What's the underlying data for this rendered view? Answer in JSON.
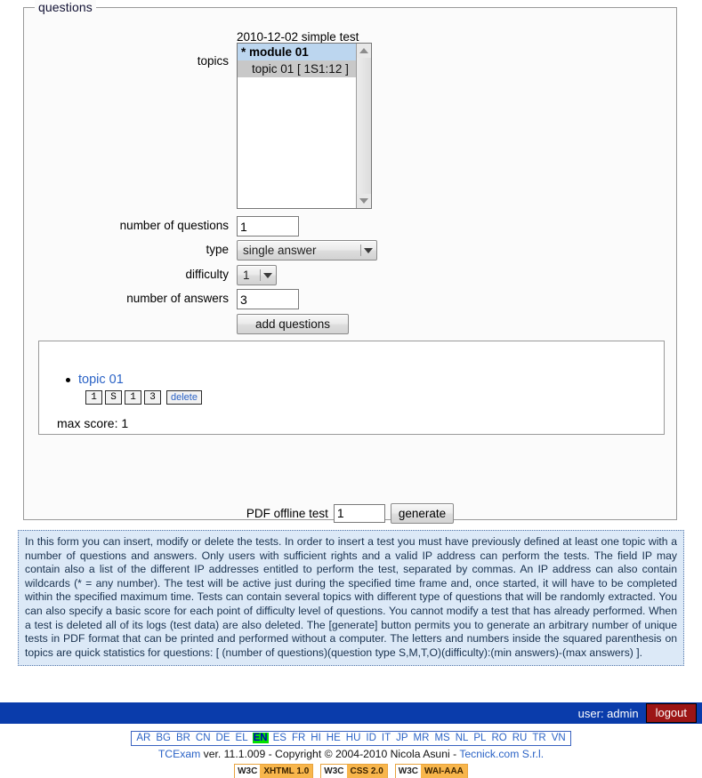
{
  "fieldset": {
    "legend": "questions"
  },
  "form": {
    "test_title": "2010-12-02 simple test",
    "topics_label": "topics",
    "topics_items": [
      {
        "text": "* module 01",
        "kind": "module"
      },
      {
        "text": "topic 01 [ 1S1:12 ]",
        "kind": "topic"
      }
    ],
    "number_of_questions_label": "number of questions",
    "number_of_questions_value": "1",
    "type_label": "type",
    "type_value": "single answer",
    "difficulty_label": "difficulty",
    "difficulty_value": "1",
    "number_of_answers_label": "number of answers",
    "number_of_answers_value": "3",
    "add_questions_label": "add questions"
  },
  "result": {
    "topic_link": "topic 01",
    "stats": [
      "1",
      "S",
      "1",
      "3"
    ],
    "delete_label": "delete",
    "max_score": "max score: 1"
  },
  "pdf": {
    "label": "PDF offline test",
    "value": "1",
    "generate_label": "generate"
  },
  "help": {
    "text": "In this form you can insert, modify or delete the tests. In order to insert a test you must have previously defined at least one topic with a number of questions and answers. Only users with sufficient rights and a valid IP address can perform the tests. The field IP may contain also a list of the different IP addresses entitled to perform the test, separated by commas. An IP address can also contain wildcards (* = any number). The test will be active just during the specified time frame and, once started, it will have to be completed within the specified maximum time. Tests can contain several topics with different type of questions that will be randomly extracted. You can also specify a basic score for each point of difficulty level of questions. You cannot modify a test that has already performed. When a test is deleted all of its logs (test data) are also deleted. The [generate] button permits you to generate an arbitrary number of unique tests in PDF format that can be printed and performed without a computer. The letters and numbers inside the squared parenthesis on topics are quick statistics for questions: [ (number of questions)(question type S,M,T,O)(difficulty):(min answers)-(max answers) ]."
  },
  "userbar": {
    "user": "user: admin",
    "logout": "logout",
    "bar_color": "#0a3cab",
    "logout_color": "#9c1515"
  },
  "languages": {
    "items": [
      "AR",
      "BG",
      "BR",
      "CN",
      "DE",
      "EL",
      "EN",
      "ES",
      "FR",
      "HI",
      "HE",
      "HU",
      "ID",
      "IT",
      "JP",
      "MR",
      "MS",
      "NL",
      "PL",
      "RO",
      "RU",
      "TR",
      "VN"
    ],
    "active": "EN",
    "active_color": "#00e000"
  },
  "copyright": {
    "app": "TCExam",
    "text": " ver. 11.1.009 - Copyright © 2004-2010 Nicola Asuni - ",
    "vendor": "Tecnick.com S.r.l."
  },
  "badges": [
    {
      "left": "W3C",
      "right": "XHTML 1.0"
    },
    {
      "left": "W3C",
      "right": "CSS 2.0"
    },
    {
      "left": "W3C",
      "right": "WAI-AAA"
    }
  ]
}
